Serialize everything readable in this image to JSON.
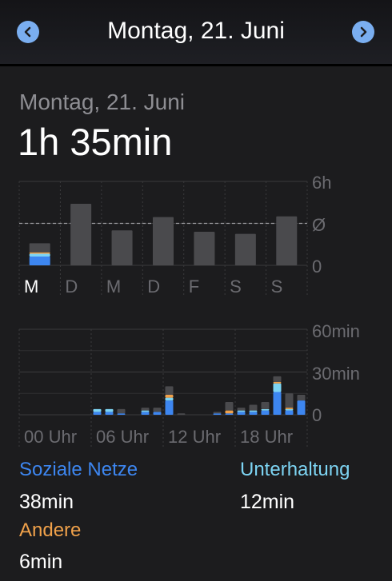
{
  "header": {
    "title": "Montag, 21. Juni",
    "prev_icon": "chevron-left-icon",
    "next_icon": "chevron-right-icon",
    "accent": "#7aaef0"
  },
  "summary": {
    "date": "Montag, 21. Juni",
    "total": "1h 35min"
  },
  "chart_data": [
    {
      "type": "bar",
      "title": "",
      "categories": [
        "M",
        "D",
        "M",
        "D",
        "F",
        "S",
        "S"
      ],
      "y_tick_labels": [
        "6h",
        "Ø",
        "0"
      ],
      "ylim": [
        0,
        6
      ],
      "average": 3.0,
      "average_label": "Ø",
      "series": [
        {
          "name": "Soziale Netze",
          "color": "#3d86f0",
          "values": [
            0.63,
            0,
            0,
            0,
            0,
            0,
            0
          ]
        },
        {
          "name": "Unterhaltung",
          "color": "#7dd4f3",
          "values": [
            0.2,
            0,
            0,
            0,
            0,
            0,
            0
          ]
        },
        {
          "name": "Andere",
          "color": "#f0a14a",
          "values": [
            0.1,
            0,
            0,
            0,
            0,
            0,
            0
          ]
        },
        {
          "name": "",
          "color": "#4a4a4d",
          "values": [
            0.65,
            4.4,
            2.5,
            3.45,
            2.4,
            2.25,
            3.5
          ]
        }
      ]
    },
    {
      "type": "bar",
      "title": "",
      "categories": [
        "00",
        "01",
        "02",
        "03",
        "04",
        "05",
        "06",
        "07",
        "08",
        "09",
        "10",
        "11",
        "12",
        "13",
        "14",
        "15",
        "16",
        "17",
        "18",
        "19",
        "20",
        "21",
        "22",
        "23"
      ],
      "x_tick_labels": [
        "00 Uhr",
        "06 Uhr",
        "12 Uhr",
        "18 Uhr"
      ],
      "y_tick_labels": [
        "60min",
        "30min",
        "0"
      ],
      "ylim": [
        0,
        60
      ],
      "series": [
        {
          "name": "Soziale Netze",
          "color": "#3d86f0",
          "values": [
            0,
            0,
            0,
            0,
            0,
            0,
            2,
            2,
            1,
            0,
            2,
            2,
            10,
            0,
            0,
            0,
            1,
            1,
            2,
            2,
            3,
            16,
            3,
            10
          ]
        },
        {
          "name": "Unterhaltung",
          "color": "#7dd4f3",
          "values": [
            0,
            0,
            0,
            0,
            0,
            0,
            2,
            2,
            0,
            0,
            1,
            0,
            2,
            0,
            0,
            0,
            0,
            0,
            1,
            1,
            1,
            6,
            1,
            0
          ]
        },
        {
          "name": "Andere",
          "color": "#f0a14a",
          "values": [
            0,
            0,
            0,
            0,
            0,
            0,
            0,
            0,
            0,
            0,
            0,
            0,
            2,
            0,
            0,
            0,
            0,
            2,
            0,
            0,
            0,
            1,
            1,
            0
          ]
        },
        {
          "name": "",
          "color": "#4a4a4d",
          "values": [
            0,
            0,
            0,
            0,
            0,
            0,
            0,
            0,
            3,
            0,
            2,
            3,
            6,
            1,
            0,
            0,
            1,
            6,
            2,
            4,
            5,
            4,
            10,
            4
          ]
        }
      ]
    }
  ],
  "categories": [
    {
      "name": "Soziale Netze",
      "time": "38min",
      "color": "#3d86f0"
    },
    {
      "name": "Unterhaltung",
      "time": "12min",
      "color": "#7dd4f3"
    },
    {
      "name": "Andere",
      "time": "6min",
      "color": "#f0a14a"
    }
  ]
}
